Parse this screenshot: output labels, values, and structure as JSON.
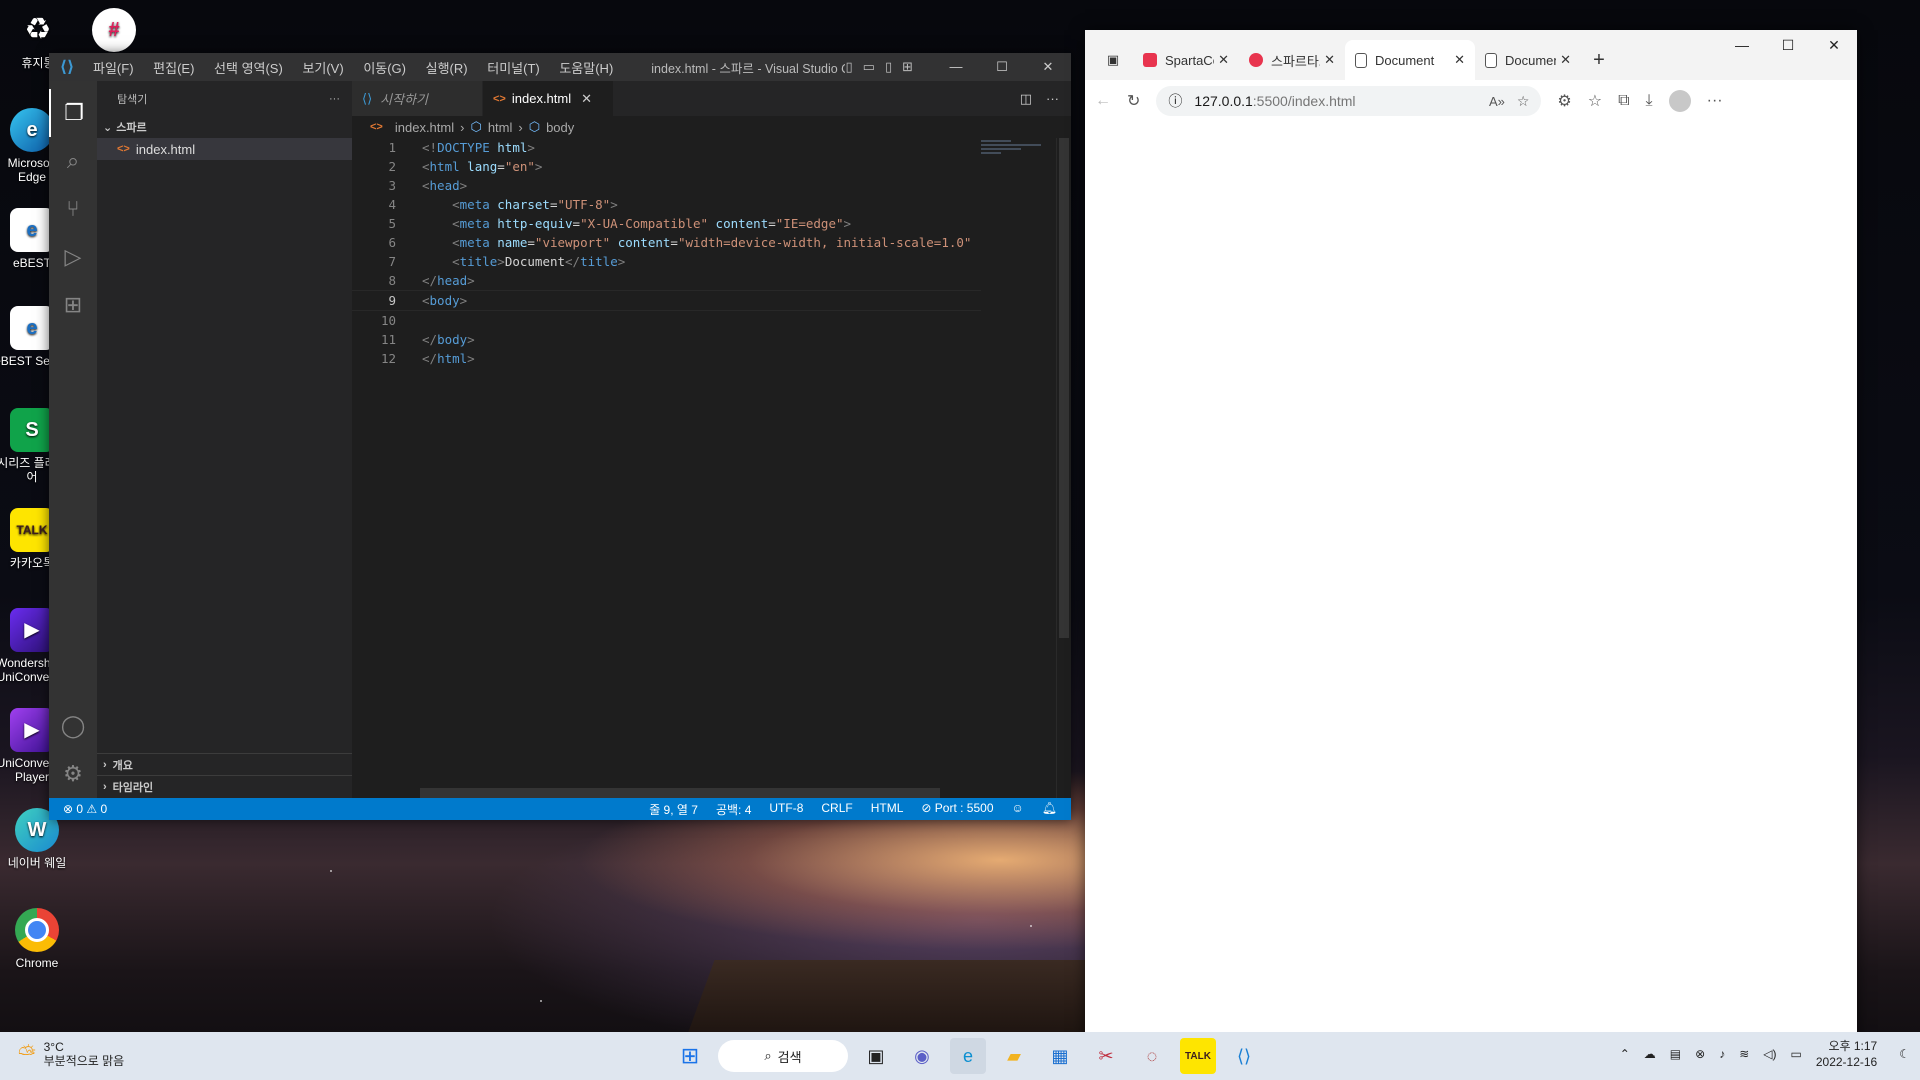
{
  "desktop": {
    "icons": [
      {
        "label": "휴지통"
      },
      {
        "label": "Microsoft Edge"
      },
      {
        "label": "eBEST"
      },
      {
        "label": "eBEST Secret"
      },
      {
        "label": "시리즈 플레이어"
      },
      {
        "label": "카카오톡"
      },
      {
        "label": "Wondershare UniConverter"
      },
      {
        "label": "UniConverter Player"
      },
      {
        "label": "네이버 웨일"
      },
      {
        "label": "Chrome"
      }
    ]
  },
  "vscode": {
    "menu": [
      "파일(F)",
      "편집(E)",
      "선택 영역(S)",
      "보기(V)",
      "이동(G)",
      "실행(R)",
      "터미널(T)",
      "도움말(H)"
    ],
    "window_title": "index.html - 스파르 - Visual Studio Co...",
    "explorer_title": "탐색기",
    "folder": "스파르",
    "file": "index.html",
    "panel_outline": "개요",
    "panel_timeline": "타임라인",
    "tabs": [
      {
        "label": "시작하기"
      },
      {
        "label": "index.html"
      }
    ],
    "breadcrumb": {
      "file": "index.html",
      "html": "html",
      "body": "body"
    },
    "code_lines": [
      {
        "n": "1",
        "parts": [
          [
            "t",
            "<!"
          ],
          [
            "tg",
            "DOCTYPE"
          ],
          [
            "tx",
            " "
          ],
          [
            "at",
            "html"
          ],
          [
            "t",
            ">"
          ]
        ]
      },
      {
        "n": "2",
        "parts": [
          [
            "t",
            "<"
          ],
          [
            "tg",
            "html"
          ],
          [
            "tx",
            " "
          ],
          [
            "at",
            "lang"
          ],
          [
            "tx",
            "="
          ],
          [
            "st",
            "\"en\""
          ],
          [
            "t",
            ">"
          ]
        ]
      },
      {
        "n": "3",
        "parts": [
          [
            "t",
            "<"
          ],
          [
            "tg",
            "head"
          ],
          [
            "t",
            ">"
          ]
        ]
      },
      {
        "n": "4",
        "parts": [
          [
            "tx",
            "    "
          ],
          [
            "t",
            "<"
          ],
          [
            "tg",
            "meta"
          ],
          [
            "tx",
            " "
          ],
          [
            "at",
            "charset"
          ],
          [
            "tx",
            "="
          ],
          [
            "st",
            "\"UTF-8\""
          ],
          [
            "t",
            ">"
          ]
        ]
      },
      {
        "n": "5",
        "parts": [
          [
            "tx",
            "    "
          ],
          [
            "t",
            "<"
          ],
          [
            "tg",
            "meta"
          ],
          [
            "tx",
            " "
          ],
          [
            "at",
            "http-equiv"
          ],
          [
            "tx",
            "="
          ],
          [
            "st",
            "\"X-UA-Compatible\""
          ],
          [
            "tx",
            " "
          ],
          [
            "at",
            "content"
          ],
          [
            "tx",
            "="
          ],
          [
            "st",
            "\"IE=edge\""
          ],
          [
            "t",
            ">"
          ]
        ]
      },
      {
        "n": "6",
        "parts": [
          [
            "tx",
            "    "
          ],
          [
            "t",
            "<"
          ],
          [
            "tg",
            "meta"
          ],
          [
            "tx",
            " "
          ],
          [
            "at",
            "name"
          ],
          [
            "tx",
            "="
          ],
          [
            "st",
            "\"viewport\""
          ],
          [
            "tx",
            " "
          ],
          [
            "at",
            "content"
          ],
          [
            "tx",
            "="
          ],
          [
            "st",
            "\"width=device-width, initial-scale=1.0\""
          ]
        ]
      },
      {
        "n": "7",
        "parts": [
          [
            "tx",
            "    "
          ],
          [
            "t",
            "<"
          ],
          [
            "tg",
            "title"
          ],
          [
            "t",
            ">"
          ],
          [
            "tx",
            "Document"
          ],
          [
            "t",
            "</"
          ],
          [
            "tg",
            "title"
          ],
          [
            "t",
            ">"
          ]
        ]
      },
      {
        "n": "8",
        "parts": [
          [
            "t",
            "</"
          ],
          [
            "tg",
            "head"
          ],
          [
            "t",
            ">"
          ]
        ]
      },
      {
        "n": "9",
        "parts": [
          [
            "t",
            "<"
          ],
          [
            "tg",
            "body"
          ],
          [
            "t",
            ">"
          ]
        ]
      },
      {
        "n": "10",
        "parts": []
      },
      {
        "n": "11",
        "parts": [
          [
            "t",
            "</"
          ],
          [
            "tg",
            "body"
          ],
          [
            "t",
            ">"
          ]
        ]
      },
      {
        "n": "12",
        "parts": [
          [
            "t",
            "</"
          ],
          [
            "tg",
            "html"
          ],
          [
            "t",
            ">"
          ]
        ]
      }
    ],
    "status": {
      "problems": "⊗ 0 ⚠ 0",
      "position": "줄 9, 열 7",
      "spaces": "공백: 4",
      "encoding": "UTF-8",
      "eol": "CRLF",
      "language": "HTML",
      "port": "⊘ Port : 5500"
    }
  },
  "edge": {
    "tabs": [
      {
        "label": "SpartaCodin",
        "color": "#e8344e"
      },
      {
        "label": "스파르타코",
        "color": "#e8344e"
      },
      {
        "label": "Document",
        "color": "#888888"
      },
      {
        "label": "Document",
        "color": "#888888"
      }
    ],
    "url_host": "127.0.0.1",
    "url_path": ":5500/index.html"
  },
  "taskbar": {
    "temp": "3°C",
    "weather": "부분적으로 맑음",
    "search": "검색",
    "time": "오후 1:17",
    "date": "2022-12-16"
  }
}
